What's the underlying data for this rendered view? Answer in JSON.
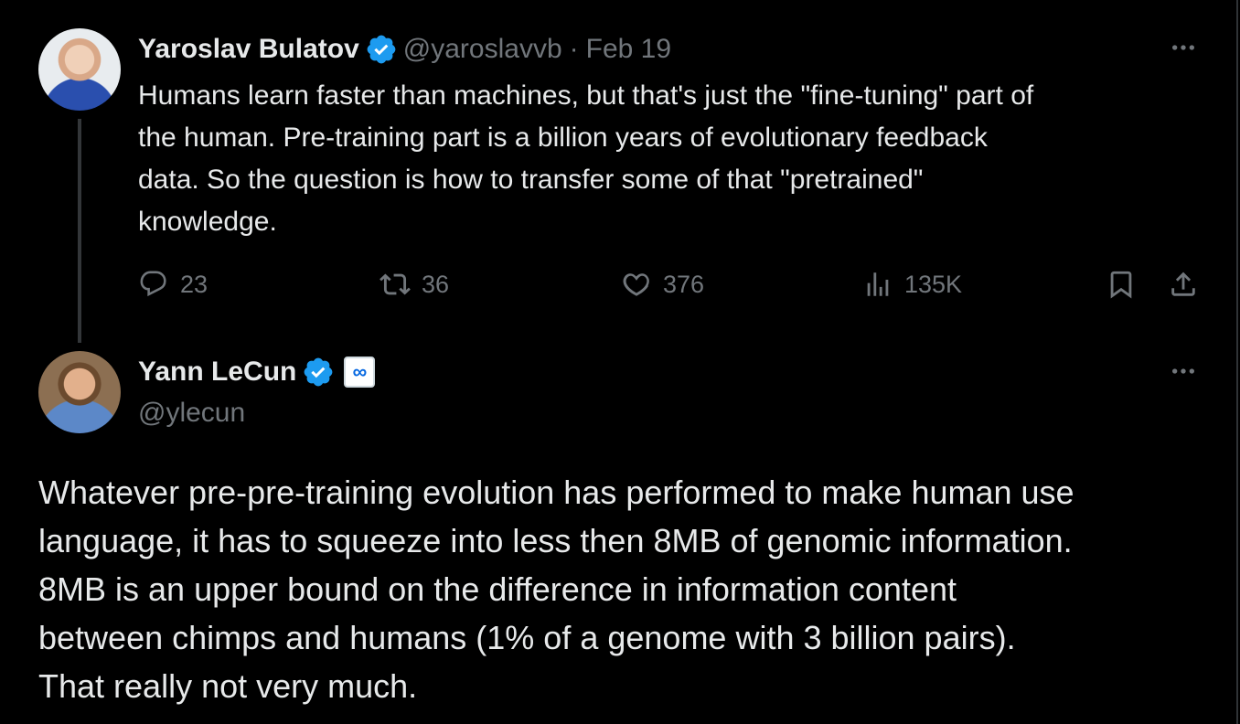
{
  "parent_tweet": {
    "author_name": "Yaroslav Bulatov",
    "handle": "@yaroslavvb",
    "separator": "·",
    "date": "Feb 19",
    "text": "Humans learn faster than machines, but that's just the \"fine-tuning\" part of\nthe human. Pre-training part is a billion years of evolutionary feedback\ndata. So the question is how to transfer some of that \"pretrained\"\nknowledge.",
    "stats": {
      "replies": "23",
      "reposts": "36",
      "likes": "376",
      "views": "135K"
    },
    "more_icon": "ellipsis-icon"
  },
  "main_tweet": {
    "author_name": "Yann LeCun",
    "handle": "@ylecun",
    "affiliation_icon": "meta-logo-icon",
    "text": "Whatever pre-pre-training evolution has performed to make human use\nlanguage, it has to squeeze into less then 8MB of genomic information.\n8MB is an upper bound on the difference in information content\nbetween chimps and humans (1% of a genome with 3 billion pairs).\nThat really not very much.",
    "more_icon": "ellipsis-icon"
  },
  "colors": {
    "background": "#000000",
    "text_primary": "#e7e9ea",
    "text_secondary": "#71767b",
    "verified_blue": "#1d9bf0",
    "thread_line": "#333639"
  }
}
